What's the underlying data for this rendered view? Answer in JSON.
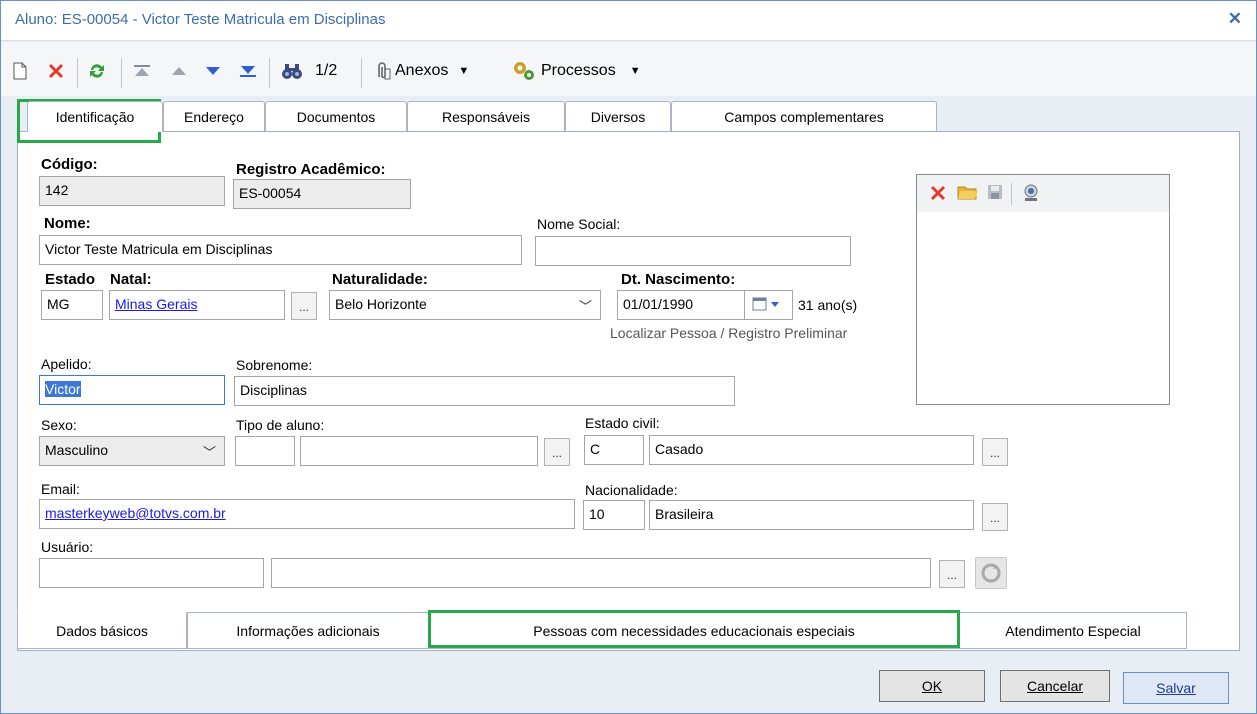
{
  "window": {
    "title": "Aluno: ES-00054 - Victor Teste Matricula em Disciplinas",
    "close_symbol": "✕"
  },
  "toolbar": {
    "record_counter": "1/2",
    "anexos_label": "Anexos",
    "processos_label": "Processos",
    "icons": [
      "new-document-icon",
      "delete-icon",
      "refresh-icon",
      "first-record-icon",
      "previous-record-icon",
      "next-record-icon",
      "last-record-icon",
      "binoculars-icon",
      "paperclip-icon",
      "processes-gear-icon"
    ]
  },
  "top_tabs": [
    {
      "label": "Identificação",
      "active": true
    },
    {
      "label": "Endereço"
    },
    {
      "label": "Documentos"
    },
    {
      "label": "Responsáveis"
    },
    {
      "label": "Diversos"
    },
    {
      "label": "Campos complementares"
    }
  ],
  "form": {
    "codigo": {
      "label": "Código:",
      "value": "142"
    },
    "registro": {
      "label": "Registro Acadêmico:",
      "value": "ES-00054"
    },
    "nome": {
      "label": "Nome:",
      "value": "Victor Teste Matricula em Disciplinas"
    },
    "nome_social": {
      "label": "Nome Social:",
      "value": ""
    },
    "estado_natal": {
      "label_a": "Estado",
      "label_b": "Natal:",
      "code": "MG",
      "name": "Minas Gerais"
    },
    "naturalidade": {
      "label": "Naturalidade:",
      "value": "Belo Horizonte"
    },
    "nascimento": {
      "label": "Dt. Nascimento:",
      "value": "01/01/1990",
      "age": "31 ano(s)"
    },
    "localizar_link": "Localizar Pessoa / Registro Preliminar",
    "apelido": {
      "label": "Apelido:",
      "value": "Victor"
    },
    "sobrenome": {
      "label": "Sobrenome:",
      "value": "Disciplinas"
    },
    "sexo": {
      "label": "Sexo:",
      "value": "Masculino"
    },
    "tipo_aluno": {
      "label": "Tipo de aluno:",
      "code": "",
      "name": ""
    },
    "estado_civil": {
      "label": "Estado civil:",
      "code": "C",
      "name": "Casado"
    },
    "email": {
      "label": "Email:",
      "value": "masterkeyweb@totvs.com.br"
    },
    "nacionalidade": {
      "label": "Nacionalidade:",
      "code": "10",
      "name": "Brasileira"
    },
    "usuario": {
      "label": "Usuário:",
      "code": "",
      "name": ""
    },
    "ellipsis": "..."
  },
  "bottom_tabs": [
    {
      "label": "Dados básicos",
      "active": true
    },
    {
      "label": "Informações adicionais"
    },
    {
      "label": "Pessoas com necessidades educacionais especiais"
    },
    {
      "label": "Atendimento Especial"
    }
  ],
  "footer": {
    "ok": "OK",
    "cancelar": "Cancelar",
    "salvar": "Salvar"
  },
  "colors": {
    "title": "#3c6ea8",
    "highlight_green": "#27a84a",
    "link": "#1a1ae6"
  }
}
